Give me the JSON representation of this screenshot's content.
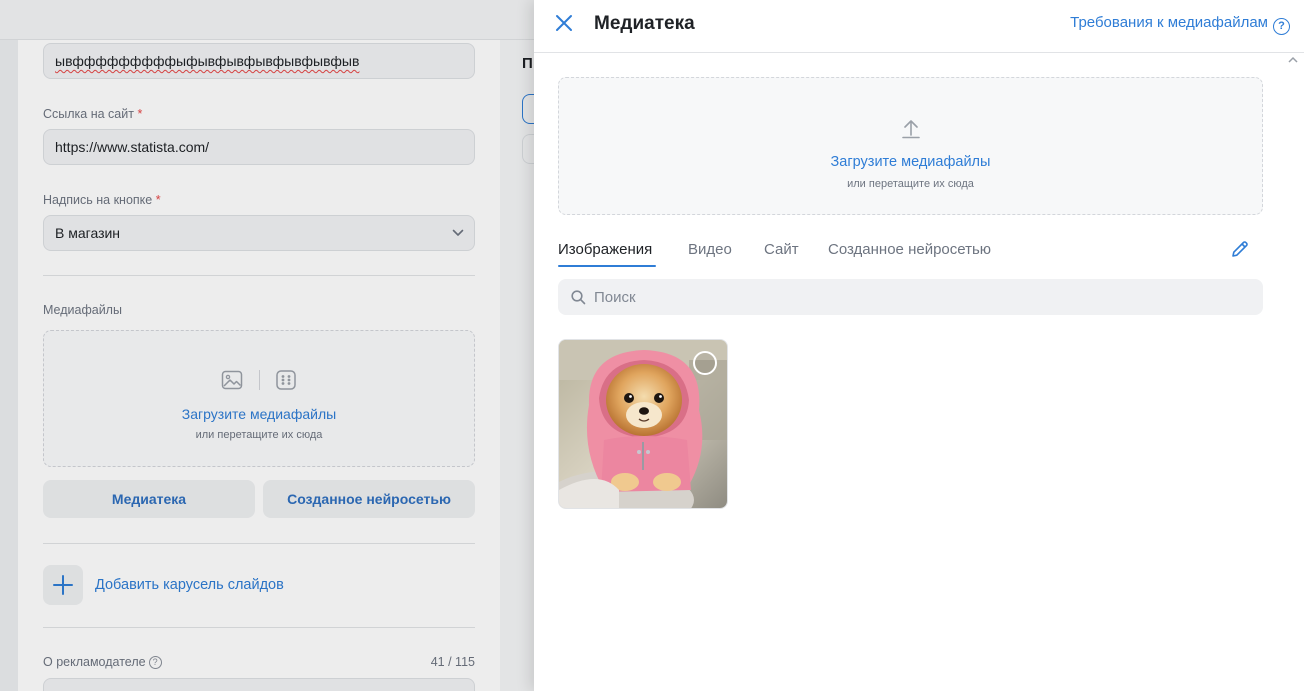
{
  "form": {
    "headline_value": "ывфффффффффыфывфывфывфывфывфыв",
    "site_link_label": "Ссылка на сайт",
    "site_link_value": "https://www.statista.com/",
    "button_label_label": "Надпись на кнопке",
    "button_label_value": "В магазин",
    "required_mark": "*",
    "media_label": "Медиафайлы",
    "media_upload_title": "Загрузите медиафайлы",
    "media_upload_sub": "или перетащите их сюда",
    "library_button": "Медиатека",
    "ai_button": "Созданное нейросетью",
    "add_carousel": "Добавить карусель слайдов",
    "about_label": "О рекламодателе",
    "about_help": "?",
    "about_count": "41 / 115"
  },
  "right_column": {
    "cut_letter": "П"
  },
  "drawer": {
    "title": "Медиатека",
    "requirements_link": "Требования к медиафайлам",
    "help_glyph": "?",
    "upload_title": "Загрузите медиафайлы",
    "upload_sub": "или перетащите их сюда",
    "tabs": [
      "Изображения",
      "Видео",
      "Сайт",
      "Созданное нейросетью"
    ],
    "active_tab": 0,
    "search_placeholder": "Поиск",
    "images": [
      {
        "subject": "pomeranian-in-pink-hoodie",
        "selected": false
      }
    ]
  },
  "colors": {
    "accent": "#2f7dd6",
    "required": "#e64646",
    "muted_text": "#6d7480"
  }
}
